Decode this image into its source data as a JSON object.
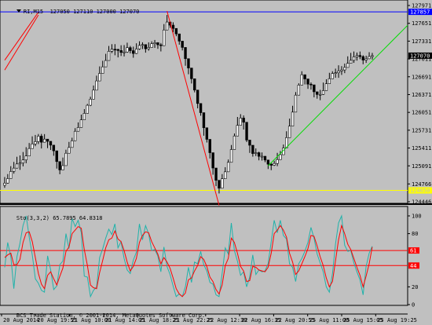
{
  "window": {
    "symbol_header": "RI,M15",
    "ohlc_text": "127050 127110 127000 127070",
    "footer_text": "BCS Trade Station, © 2001-2014, MetaQuotes Software Corp."
  },
  "colors": {
    "background": "#c0c0c0",
    "candle_up": "#ffffff",
    "candle_down": "#000000",
    "blue_line": "#0000ff",
    "red_line": "#ff0000",
    "green_line": "#00dd00",
    "yellow_line": "#ffff00",
    "stoch_main": "#20b2aa",
    "stoch_signal": "#ff0000",
    "stoch_levels": "#ff0000"
  },
  "chart_data": [
    {
      "type": "candlestick",
      "symbol": "RI,M15",
      "y_ticks": [
        124446,
        124766,
        125091,
        125411,
        125731,
        126051,
        126371,
        126691,
        127011,
        127331,
        127651,
        127971
      ],
      "ylim": [
        124446,
        127971
      ],
      "horizontal_lines": [
        {
          "value": 127857,
          "color": "#0000ff",
          "label": "127857"
        },
        {
          "value": 124650,
          "color": "#ffff00",
          "label": "124650"
        }
      ],
      "current_price": 127070,
      "x_tick_labels": [
        "20 Aug 2014",
        "20 Aug 19:55",
        "21 Aug 10:00",
        "21 Aug 14:05",
        "21 Aug 18:25",
        "21 Aug 22:25",
        "22 Aug 12:30",
        "22 Aug 16:35",
        "22 Aug 20:55",
        "25 Aug 11:00",
        "25 Aug 15:05",
        "25 Aug 19:25"
      ],
      "trendlines": [
        {
          "color": "#ff0000",
          "from": [
            0,
            126811
          ],
          "to": [
            11,
            127800
          ]
        },
        {
          "color": "#ff0000",
          "from": [
            0,
            126988
          ],
          "to": [
            11,
            127850
          ]
        },
        {
          "color": "#ff0000",
          "from": [
            53,
            127871
          ],
          "to": [
            70,
            124380
          ]
        },
        {
          "color": "#00dd00",
          "from": [
            86,
            125091
          ],
          "to": [
            121,
            127031
          ]
        }
      ],
      "close": [
        124781,
        124862,
        124990,
        125050,
        125125,
        125142,
        125197,
        125268,
        125402,
        125485,
        125526,
        125624,
        125515,
        125571,
        125532,
        125463,
        125361,
        125168,
        125018,
        125095,
        125317,
        125421,
        125542,
        125712,
        125781,
        125918,
        126034,
        126179,
        126289,
        126451,
        126616,
        126751,
        126869,
        126983,
        127149,
        127185,
        127184,
        127163,
        127128,
        127136,
        127214,
        127160,
        127109,
        127190,
        127254,
        127269,
        127194,
        127218,
        127285,
        127303,
        127265,
        127249,
        127531,
        127674,
        127618,
        127559,
        127461,
        127331,
        127218,
        127016,
        126848,
        126655,
        126452,
        126211,
        126046,
        125775,
        125567,
        125327,
        125052,
        124832,
        124689,
        124859,
        124984,
        125154,
        125384,
        125627,
        125819,
        125950,
        125874,
        125554,
        125461,
        125312,
        125327,
        125262,
        125263,
        125196,
        125121,
        125102,
        125134,
        125203,
        125291,
        125411,
        125598,
        125804,
        126056,
        126361,
        126542,
        126728,
        126652,
        126558,
        126546,
        126421,
        126373,
        126374,
        126442,
        126566,
        126656,
        126750,
        126763,
        126794,
        126814,
        126858,
        126932,
        126986,
        127049,
        127073,
        127054,
        126991,
        127014,
        127054,
        127070
      ],
      "high": [
        124890,
        124943,
        125085,
        125161,
        125254,
        125278,
        125339,
        125426,
        125501,
        125621,
        125646,
        125663,
        125664,
        125661,
        125570,
        125532,
        125440,
        125293,
        125140,
        125240,
        125381,
        125521,
        125596,
        125768,
        125871,
        126011,
        126110,
        126203,
        126332,
        126534,
        126711,
        126877,
        126978,
        127103,
        127244,
        127276,
        127277,
        127189,
        127257,
        127260,
        127303,
        127244,
        127232,
        127292,
        127329,
        127310,
        127245,
        127309,
        127327,
        127352,
        127311,
        127297,
        127637,
        127800,
        127680,
        127669,
        127547,
        127386,
        127312,
        127102,
        126939,
        126692,
        126549,
        126346,
        126108,
        125850,
        125618,
        125406,
        125149,
        124900,
        124800,
        124943,
        125066,
        125205,
        125465,
        125672,
        125969,
        126019,
        125996,
        125614,
        125551,
        125403,
        125404,
        125345,
        125332,
        125267,
        125153,
        125150,
        125182,
        125324,
        125358,
        125474,
        125712,
        125939,
        126170,
        126416,
        126574,
        126790,
        126728,
        126625,
        126590,
        126508,
        126398,
        126456,
        126587,
        126646,
        126762,
        126790,
        126837,
        126897,
        126882,
        126928,
        127058,
        127120,
        127145,
        127126,
        127144,
        127077,
        127069,
        127132,
        127120
      ],
      "low": [
        124696,
        124770,
        124877,
        124951,
        125043,
        125019,
        125082,
        125138,
        125348,
        125412,
        125444,
        125482,
        125403,
        125518,
        125409,
        125376,
        125272,
        125042,
        124940,
        125032,
        125223,
        125331,
        125460,
        125676,
        125716,
        125813,
        125929,
        126115,
        126164,
        126318,
        126514,
        126668,
        126770,
        126895,
        127040,
        127116,
        127077,
        127039,
        127064,
        127056,
        127122,
        127110,
        127033,
        127099,
        127174,
        127189,
        127124,
        127159,
        127239,
        127210,
        127193,
        127146,
        127358,
        127589,
        127569,
        127490,
        127419,
        127267,
        127164,
        126889,
        126736,
        126570,
        126411,
        126124,
        125991,
        125632,
        125510,
        125223,
        124932,
        124727,
        124595,
        124737,
        124928,
        125074,
        125265,
        125580,
        125740,
        125883,
        125743,
        125518,
        125323,
        125256,
        125267,
        125190,
        125186,
        125157,
        125034,
        125013,
        125089,
        125085,
        125257,
        125337,
        125541,
        125723,
        126000,
        126266,
        126414,
        126664,
        126553,
        126474,
        126460,
        126322,
        126297,
        126270,
        126365,
        126516,
        126628,
        126693,
        126673,
        126672,
        126724,
        126756,
        126895,
        126963,
        126941,
        126981,
        127007,
        126916,
        126940,
        127009,
        127000
      ]
    },
    {
      "type": "line",
      "title": "Sto(3,3,2) 65.7895 64.8318",
      "parameters": "3,3,2",
      "current_values": [
        65.7895,
        64.8318
      ],
      "y_ticks": [
        0,
        20,
        44,
        61,
        80,
        100
      ],
      "ylim": [
        0,
        100
      ],
      "levels": [
        61,
        44
      ],
      "series": [
        {
          "values": [
            42,
            70,
            54,
            18,
            54,
            69,
            89,
            100,
            76,
            56,
            29,
            24,
            16,
            14,
            55,
            39,
            17,
            21,
            45,
            49,
            80,
            63,
            97,
            88,
            95,
            81,
            32,
            31,
            9,
            16,
            20,
            53,
            63,
            75,
            85,
            79,
            91,
            64,
            71,
            52,
            39,
            35,
            50,
            59,
            91,
            73,
            89,
            80,
            61,
            62,
            55,
            37,
            65,
            43,
            34,
            21,
            9,
            12,
            9,
            20,
            42,
            25,
            48,
            46,
            60,
            45,
            38,
            25,
            23,
            11,
            9,
            35,
            64,
            57,
            92,
            61,
            49,
            33,
            37,
            20,
            31,
            56,
            34,
            39,
            37,
            38,
            46,
            71,
            95,
            81,
            95,
            78,
            74,
            46,
            42,
            26,
            46,
            52,
            60,
            70,
            87,
            75,
            57,
            47,
            37,
            20,
            14,
            35,
            68,
            92,
            100,
            67,
            60,
            61,
            47,
            37,
            28,
            11,
            43,
            58,
            65.7895
          ]
        },
        {
          "values": [
            53,
            56,
            58,
            45,
            45,
            51,
            70,
            81,
            82,
            71,
            53,
            35,
            23,
            18,
            33,
            37,
            29,
            22,
            32,
            41,
            60,
            65,
            80,
            84,
            88,
            86,
            62,
            44,
            22,
            19,
            18,
            36,
            50,
            64,
            73,
            75,
            83,
            74,
            71,
            61,
            48,
            38,
            43,
            52,
            70,
            78,
            82,
            81,
            71,
            64,
            57,
            46,
            53,
            48,
            41,
            30,
            18,
            12,
            9,
            13,
            28,
            30,
            38,
            44,
            54,
            51,
            43,
            31,
            26,
            17,
            12,
            22,
            44,
            52,
            75,
            70,
            58,
            43,
            38,
            26,
            27,
            43,
            42,
            39,
            38,
            37,
            42,
            58,
            80,
            84,
            89,
            84,
            76,
            58,
            48,
            34,
            38,
            46,
            54,
            63,
            78,
            77,
            66,
            54,
            44,
            30,
            20,
            26,
            49,
            73,
            89,
            80,
            68,
            62,
            52,
            42,
            33,
            20,
            32,
            46,
            64.8318
          ]
        }
      ]
    }
  ]
}
